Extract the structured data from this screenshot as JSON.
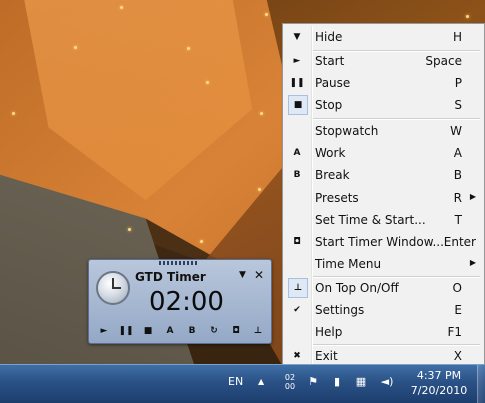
{
  "timer_widget": {
    "title": "GTD Timer",
    "time": "02:00",
    "menu_glyph": "▼",
    "close_glyph": "✕",
    "controls": [
      {
        "name": "play-icon",
        "glyph": "►"
      },
      {
        "name": "pause-icon",
        "glyph": "❚❚"
      },
      {
        "name": "stop-icon",
        "glyph": "■"
      },
      {
        "name": "work-icon",
        "glyph": "A"
      },
      {
        "name": "break-icon",
        "glyph": "B"
      },
      {
        "name": "restart-icon",
        "glyph": "↻"
      },
      {
        "name": "window-icon",
        "glyph": "◘"
      },
      {
        "name": "pin-icon",
        "glyph": "⊥"
      }
    ]
  },
  "menu": {
    "items": [
      {
        "label": "Hide",
        "key": "H",
        "icon": "▼",
        "icon_name": "hide-icon"
      },
      {
        "label": "Start",
        "key": "Space",
        "icon": "►",
        "icon_name": "start-icon"
      },
      {
        "label": "Pause",
        "key": "P",
        "icon": "❚❚",
        "icon_name": "pause-icon"
      },
      {
        "label": "Stop",
        "key": "S",
        "icon": "■",
        "icon_name": "stop-icon",
        "checked": true
      },
      {
        "label": "Stopwatch",
        "key": "W",
        "icon": "",
        "icon_name": "stopwatch-icon"
      },
      {
        "label": "Work",
        "key": "A",
        "icon": "A",
        "icon_name": "work-icon"
      },
      {
        "label": "Break",
        "key": "B",
        "icon": "B",
        "icon_name": "break-icon"
      },
      {
        "label": "Presets",
        "key": "R",
        "icon": "",
        "icon_name": "presets-icon",
        "submenu": true
      },
      {
        "label": "Set Time & Start...",
        "key": "T",
        "icon": "",
        "icon_name": "set-time-icon"
      },
      {
        "label": "Start Timer Window...",
        "key": "Enter",
        "icon": "◘",
        "icon_name": "timer-window-icon"
      },
      {
        "label": "Time Menu",
        "key": "",
        "icon": "",
        "icon_name": "time-menu-icon",
        "submenu": true
      },
      {
        "label": "On Top On/Off",
        "key": "O",
        "icon": "⊥",
        "icon_name": "pin-icon",
        "checked": true
      },
      {
        "label": "Settings",
        "key": "E",
        "icon": "✔",
        "icon_name": "checkmark-icon"
      },
      {
        "label": "Help",
        "key": "F1",
        "icon": "",
        "icon_name": "help-icon"
      },
      {
        "label": "Exit",
        "key": "X",
        "icon": "✖",
        "icon_name": "exit-icon"
      }
    ],
    "submenu_arrow": "▶"
  },
  "taskbar": {
    "language": "EN",
    "show_hidden_glyph": "▲",
    "mini_timer_line1": "02",
    "mini_timer_line2": "00",
    "tray_icons": [
      {
        "name": "flag-icon",
        "glyph": "⚑"
      },
      {
        "name": "power-icon",
        "glyph": "▮"
      },
      {
        "name": "network-icon",
        "glyph": "▦"
      },
      {
        "name": "volume-icon",
        "glyph": "◄)"
      }
    ],
    "time": "4:37 PM",
    "date": "7/20/2010"
  }
}
